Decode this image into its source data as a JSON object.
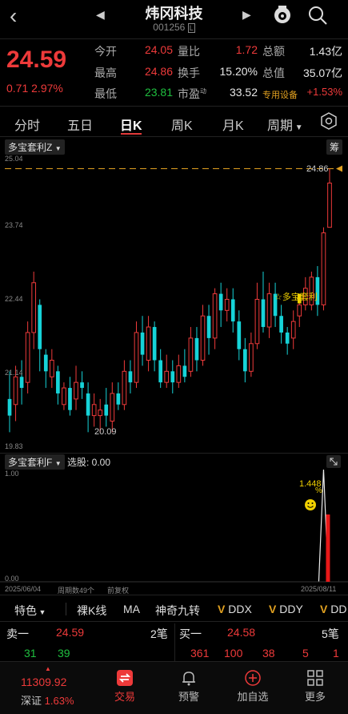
{
  "header": {
    "back_icon": "chevron-left-icon",
    "stock_name": "炜冈科技",
    "stock_code": "001256",
    "code_badge": "L",
    "prev_icon": "triangle-left-icon",
    "next_icon": "triangle-right-icon",
    "avatar_icon": "robot-face-icon",
    "search_icon": "search-icon"
  },
  "quote": {
    "price": "24.59",
    "change": "0.71",
    "change_pct": "2.97%",
    "open_label": "今开",
    "open": "24.05",
    "volratio_label": "量比",
    "volratio": "1.72",
    "amount_label": "总额",
    "amount": "1.43亿",
    "high_label": "最高",
    "high": "24.86",
    "turnover_label": "换手",
    "turnover": "15.20%",
    "mcap_label": "总值",
    "mcap": "35.07亿",
    "low_label": "最低",
    "low": "23.81",
    "pe_label": "市盈",
    "pe_sup": "动",
    "pe": "33.52",
    "sector": "专用设备",
    "sector_pct": "+1.53%"
  },
  "tabs": [
    "分时",
    "五日",
    "日K",
    "周K",
    "月K",
    "周期"
  ],
  "active_tab": "日K",
  "kpanel": {
    "label": "多宝套利Z",
    "right_btn": "筹",
    "y_ticks": [
      "25.04",
      "23.74",
      "22.44",
      "21.14",
      "19.83"
    ],
    "max_label": "24.86",
    "min_label": "20.09",
    "signal_label": "☆多宝套利"
  },
  "fpanel": {
    "label": "多宝套利F",
    "select_label": "选股: 0.00",
    "y_top": "1.00",
    "y_bottom": "0.00",
    "value_label": "1.448",
    "pct_label": "%",
    "date_start": "2025/06/04",
    "weeks_label": "周期数49个",
    "adjust_label": "前复权",
    "date_end": "2025/08/11"
  },
  "toolbar": {
    "feature": "特色",
    "items": [
      "裸K线",
      "MA",
      "神奇九转"
    ],
    "vitems": [
      "DDX",
      "DDY",
      "DD"
    ]
  },
  "orderbook": {
    "sell_label": "卖一",
    "sell_price": "24.59",
    "sell_count": "2笔",
    "buy_label": "买一",
    "buy_price": "24.58",
    "buy_count": "5笔",
    "sell_vols": [
      "31",
      "39"
    ],
    "buy_vols": [
      "361",
      "100",
      "38",
      "5",
      "1"
    ]
  },
  "bottom_nav": {
    "index_value": "11309.92",
    "index_label": "深证",
    "index_pct": "1.63%",
    "trade": "交易",
    "alert": "预警",
    "add": "加自选",
    "more": "更多"
  },
  "chart_data": {
    "type": "candlestick",
    "ylim": [
      19.83,
      25.04
    ],
    "candles": [
      {
        "o": 20.7,
        "c": 20.4,
        "h": 21.2,
        "l": 20.1
      },
      {
        "o": 20.6,
        "c": 21.1,
        "h": 21.3,
        "l": 20.3
      },
      {
        "o": 21.1,
        "c": 20.9,
        "h": 21.4,
        "l": 20.6
      },
      {
        "o": 21.0,
        "c": 21.9,
        "h": 22.1,
        "l": 20.8
      },
      {
        "o": 21.9,
        "c": 22.8,
        "h": 23.0,
        "l": 21.6
      },
      {
        "o": 22.4,
        "c": 21.6,
        "h": 22.5,
        "l": 21.2
      },
      {
        "o": 21.5,
        "c": 21.2,
        "h": 21.6,
        "l": 20.9
      },
      {
        "o": 21.1,
        "c": 21.4,
        "h": 21.6,
        "l": 20.9
      },
      {
        "o": 21.2,
        "c": 20.8,
        "h": 21.3,
        "l": 20.6
      },
      {
        "o": 20.6,
        "c": 20.9,
        "h": 21.0,
        "l": 20.5
      },
      {
        "o": 20.9,
        "c": 20.5,
        "h": 21.1,
        "l": 20.4
      },
      {
        "o": 20.7,
        "c": 21.0,
        "h": 21.3,
        "l": 20.5
      },
      {
        "o": 21.0,
        "c": 20.9,
        "h": 21.2,
        "l": 20.7
      },
      {
        "o": 20.8,
        "c": 20.4,
        "h": 21.0,
        "l": 20.1
      },
      {
        "o": 20.4,
        "c": 20.6,
        "h": 20.8,
        "l": 20.2
      },
      {
        "o": 20.4,
        "c": 20.5,
        "h": 20.7,
        "l": 20.1
      },
      {
        "o": 20.6,
        "c": 20.4,
        "h": 20.9,
        "l": 20.2
      },
      {
        "o": 20.3,
        "c": 20.8,
        "h": 21.0,
        "l": 20.1
      },
      {
        "o": 20.8,
        "c": 20.6,
        "h": 21.0,
        "l": 20.5
      },
      {
        "o": 20.6,
        "c": 21.2,
        "h": 21.4,
        "l": 20.5
      },
      {
        "o": 21.2,
        "c": 21.0,
        "h": 21.4,
        "l": 20.8
      },
      {
        "o": 21.0,
        "c": 21.9,
        "h": 22.1,
        "l": 20.9
      },
      {
        "o": 21.9,
        "c": 21.5,
        "h": 22.2,
        "l": 21.3
      },
      {
        "o": 21.4,
        "c": 22.0,
        "h": 22.2,
        "l": 21.2
      },
      {
        "o": 22.0,
        "c": 21.4,
        "h": 22.1,
        "l": 21.2
      },
      {
        "o": 21.4,
        "c": 21.0,
        "h": 21.6,
        "l": 20.9
      },
      {
        "o": 21.0,
        "c": 21.2,
        "h": 21.5,
        "l": 20.9
      },
      {
        "o": 21.2,
        "c": 21.0,
        "h": 21.4,
        "l": 20.8
      },
      {
        "o": 21.0,
        "c": 21.3,
        "h": 21.5,
        "l": 20.9
      },
      {
        "o": 21.3,
        "c": 21.1,
        "h": 21.6,
        "l": 21.0
      },
      {
        "o": 21.2,
        "c": 21.8,
        "h": 22.0,
        "l": 21.1
      },
      {
        "o": 21.8,
        "c": 21.4,
        "h": 22.0,
        "l": 21.2
      },
      {
        "o": 21.4,
        "c": 22.2,
        "h": 22.4,
        "l": 21.3
      },
      {
        "o": 22.2,
        "c": 21.8,
        "h": 22.4,
        "l": 21.5
      },
      {
        "o": 21.8,
        "c": 22.6,
        "h": 22.7,
        "l": 21.6
      },
      {
        "o": 22.6,
        "c": 22.3,
        "h": 22.8,
        "l": 22.0
      },
      {
        "o": 22.3,
        "c": 22.5,
        "h": 22.7,
        "l": 22.1
      },
      {
        "o": 22.5,
        "c": 22.1,
        "h": 22.7,
        "l": 21.9
      },
      {
        "o": 22.1,
        "c": 21.6,
        "h": 22.3,
        "l": 21.4
      },
      {
        "o": 21.6,
        "c": 21.2,
        "h": 21.8,
        "l": 21.0
      },
      {
        "o": 21.2,
        "c": 21.7,
        "h": 21.9,
        "l": 21.1
      },
      {
        "o": 21.7,
        "c": 22.5,
        "h": 22.8,
        "l": 21.6
      },
      {
        "o": 22.5,
        "c": 22.0,
        "h": 23.0,
        "l": 21.9
      },
      {
        "o": 22.0,
        "c": 22.6,
        "h": 22.8,
        "l": 21.8
      },
      {
        "o": 22.6,
        "c": 22.2,
        "h": 22.8,
        "l": 22.0
      },
      {
        "o": 22.2,
        "c": 21.9,
        "h": 22.4,
        "l": 21.7
      },
      {
        "o": 21.9,
        "c": 21.7,
        "h": 22.0,
        "l": 21.5
      },
      {
        "o": 21.8,
        "c": 22.1,
        "h": 22.3,
        "l": 21.6
      },
      {
        "o": 22.2,
        "c": 22.4,
        "h": 22.6,
        "l": 22.0
      },
      {
        "o": 22.4,
        "c": 22.7,
        "h": 22.9,
        "l": 22.3
      },
      {
        "o": 22.4,
        "c": 22.9,
        "h": 23.0,
        "l": 22.3
      },
      {
        "o": 22.9,
        "c": 22.4,
        "h": 23.1,
        "l": 22.2
      },
      {
        "o": 22.4,
        "c": 23.7,
        "h": 23.8,
        "l": 22.3
      },
      {
        "o": 23.8,
        "c": 24.6,
        "h": 24.86,
        "l": 23.81
      }
    ],
    "signal_bars": [
      0,
      0.6
    ],
    "colors": {
      "up": "#ee3a3a",
      "down": "#16d3d8",
      "marker": "#f0d000",
      "dashline": "#e0a020"
    }
  }
}
